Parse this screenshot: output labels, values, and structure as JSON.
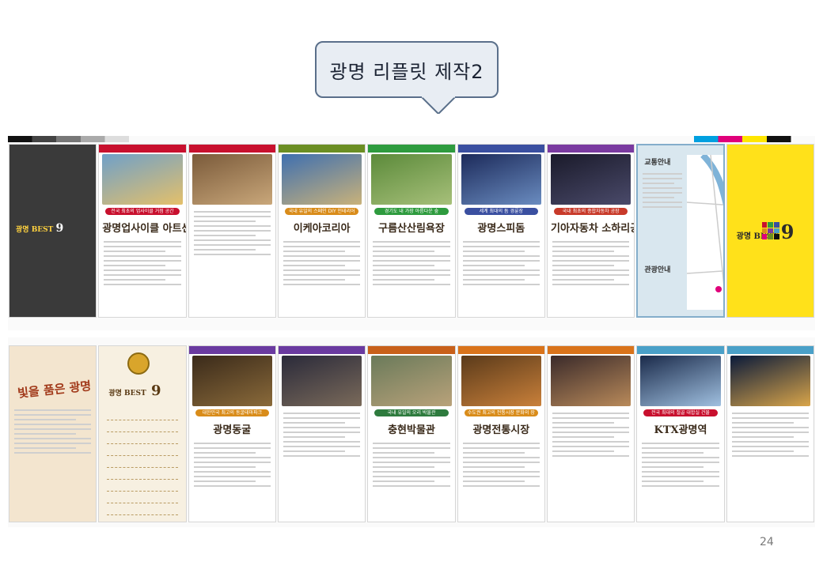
{
  "callout": {
    "title": "광명 리플릿 제작2"
  },
  "top_sheet": {
    "panels": [
      {
        "kind": "dark",
        "title_small": "광명 BEST",
        "title_num": "9",
        "band": "#3a3a3a",
        "photo": [
          "#555555",
          "#3a3a3a"
        ]
      },
      {
        "kind": "feature",
        "band": "#c8102e",
        "badge": "전국 최초의 업사이클 거점 공간",
        "badge_color": "#c8102e",
        "title": "광명업사이클 아트센터",
        "photo": [
          "#6fa0c9",
          "#e4c06a"
        ]
      },
      {
        "kind": "text",
        "band": "#c8102e",
        "photo": [
          "#7a5a3a",
          "#c9a77a"
        ]
      },
      {
        "kind": "feature",
        "band": "#6b8e23",
        "badge": "국내 유일의 스페인 DIY 인테리어",
        "badge_color": "#d98c1a",
        "title": "이케아코리아",
        "photo": [
          "#3e6fb0",
          "#c9b27a"
        ]
      },
      {
        "kind": "feature",
        "band": "#2e9b3e",
        "badge": "경기도 내 가장 아름다운 숲",
        "badge_color": "#2e9b3e",
        "title": "구름산산림욕장",
        "photo": [
          "#5b8a3a",
          "#a7c07a"
        ]
      },
      {
        "kind": "feature",
        "band": "#3a4fa0",
        "badge": "세계 최대의 돔 경륜장",
        "badge_color": "#3a4fa0",
        "title": "광명스피돔",
        "photo": [
          "#1c2a5a",
          "#6a8cc0"
        ]
      },
      {
        "kind": "feature",
        "band": "#7a3aa0",
        "badge": "국내 최초의 종합자동차 공장",
        "badge_color": "#c83a2a",
        "title": "기아자동차 소하리공장",
        "photo": [
          "#1a1a2a",
          "#4a4a6a"
        ]
      },
      {
        "kind": "map",
        "heading_1": "교통안내",
        "heading_2": "관광안내"
      },
      {
        "kind": "yellow",
        "title_small": "광명 BEST",
        "title_num": "9"
      }
    ]
  },
  "bottom_sheet": {
    "panels": [
      {
        "kind": "brown",
        "title": "빛을 품은 광명"
      },
      {
        "kind": "beige",
        "title_small": "광명 BEST",
        "title_num": "9"
      },
      {
        "kind": "feature",
        "band": "#6a3aa0",
        "badge": "대한민국 최고의 동굴테마파크",
        "badge_color": "#d98c1a",
        "title": "광명동굴",
        "photo": [
          "#3a2a1a",
          "#8a6a3a"
        ]
      },
      {
        "kind": "text",
        "band": "#6a3aa0",
        "photo": [
          "#2a2a3a",
          "#7a6a5a"
        ]
      },
      {
        "kind": "feature",
        "band": "#c8601a",
        "badge": "국내 유일의 오리 박물관",
        "badge_color": "#2e7b3e",
        "title": "충현박물관",
        "photo": [
          "#6a7a5a",
          "#b9a27a"
        ]
      },
      {
        "kind": "feature",
        "band": "#d9731a",
        "badge": "수도권 최고의 전통시장 문화의 장",
        "badge_color": "#d98c1a",
        "title": "광명전통시장",
        "photo": [
          "#5a3a1a",
          "#c9803a"
        ]
      },
      {
        "kind": "text",
        "band": "#d9731a",
        "photo": [
          "#3a2a2a",
          "#b98a5a"
        ]
      },
      {
        "kind": "feature",
        "band": "#4aa0c8",
        "badge": "전국 최대의 철골 대합실 건물",
        "badge_color": "#c8102e",
        "title": "KTX광명역",
        "photo": [
          "#1a2a4a",
          "#a0c0e0"
        ]
      },
      {
        "kind": "text",
        "band": "#4aa0c8",
        "photo": [
          "#0a1a3a",
          "#d9a54a"
        ]
      }
    ]
  },
  "page_number": "24"
}
